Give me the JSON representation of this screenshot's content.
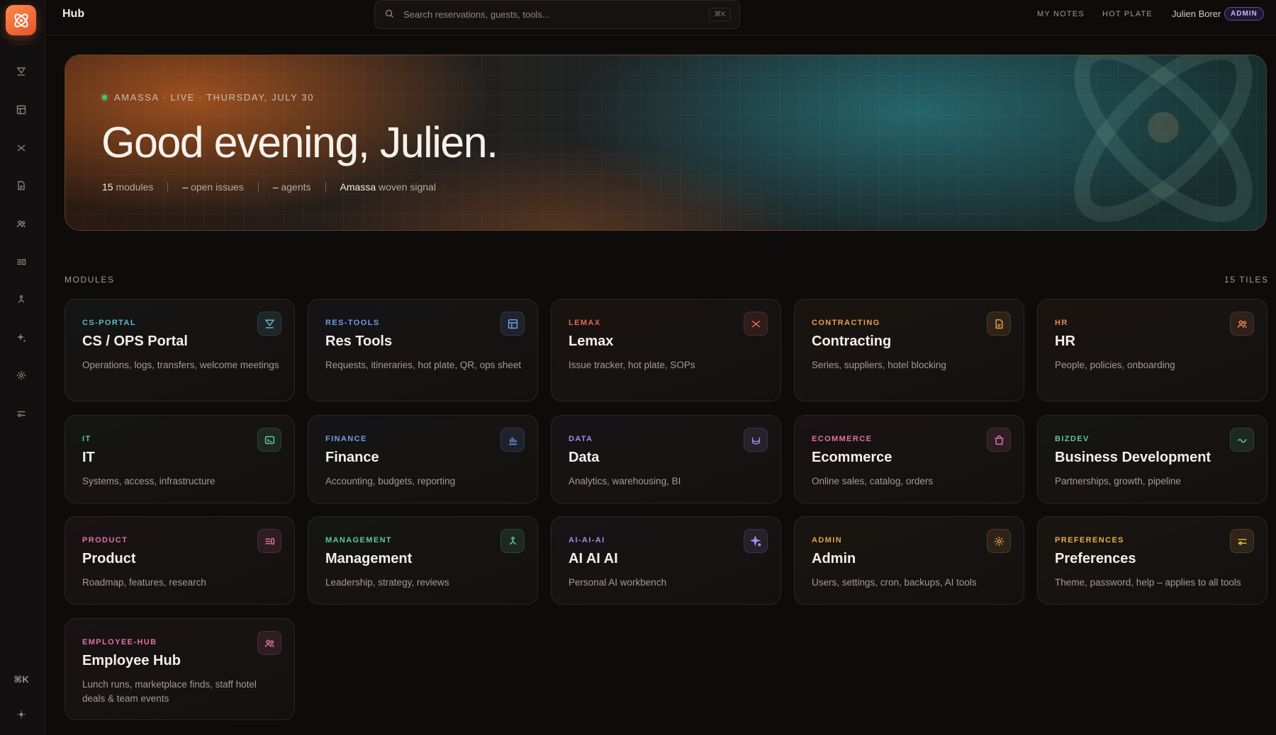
{
  "app": {
    "title": "Hub"
  },
  "search": {
    "placeholder": "Search reservations, guests, tools...",
    "shortcut": "⌘K"
  },
  "topbar": {
    "links": [
      "MY NOTES",
      "HOT PLATE"
    ],
    "user": {
      "name": "Julien Borer",
      "role": "ADMIN"
    }
  },
  "sidebar": {
    "icons": [
      "portal-icon",
      "table-icon",
      "lemax-icon",
      "document-icon",
      "people-icon",
      "product-icon",
      "management-icon",
      "sparkle-icon",
      "gear-icon",
      "sliders-icon"
    ],
    "shortcut": "⌘K",
    "theme_icon": "sun-icon"
  },
  "hero": {
    "eyebrow": "AMASSA · LIVE · THURSDAY, JULY 30",
    "greeting": "Good evening, Julien.",
    "stats": {
      "modules_count": "15",
      "modules_label": "modules",
      "issues_value": "–",
      "issues_label": "open issues",
      "agents_value": "–",
      "agents_label": "agents",
      "brand": "Amassa",
      "brand_suffix": "woven signal"
    }
  },
  "modules": {
    "label": "MODULES",
    "count_label": "15 TILES",
    "tiles": [
      {
        "tag": "CS-PORTAL",
        "name": "CS / OPS Portal",
        "desc": "Operations, logs, transfers, welcome meetings",
        "accent": "#5fb9c9",
        "icon": "portal-icon"
      },
      {
        "tag": "RES-TOOLS",
        "name": "Res Tools",
        "desc": "Requests, itineraries, hot plate, QR, ops sheet",
        "accent": "#6f9ee8",
        "icon": "table-icon"
      },
      {
        "tag": "LEMAX",
        "name": "Lemax",
        "desc": "Issue tracker, hot plate, SOPs",
        "accent": "#e06a5a",
        "icon": "lemax-icon"
      },
      {
        "tag": "CONTRACTING",
        "name": "Contracting",
        "desc": "Series, suppliers, hotel blocking",
        "accent": "#e6a04a",
        "icon": "document-icon"
      },
      {
        "tag": "HR",
        "name": "HR",
        "desc": "People, policies, onboarding",
        "accent": "#e08a5a",
        "icon": "people-icon"
      },
      {
        "tag": "IT",
        "name": "IT",
        "desc": "Systems, access, infrastructure",
        "accent": "#5fc79a",
        "icon": "terminal-icon"
      },
      {
        "tag": "FINANCE",
        "name": "Finance",
        "desc": "Accounting, budgets, reporting",
        "accent": "#6f9ee8",
        "icon": "bar-chart-icon"
      },
      {
        "tag": "DATA",
        "name": "Data",
        "desc": "Analytics, warehousing, BI",
        "accent": "#9a8ae8",
        "icon": "database-icon"
      },
      {
        "tag": "ECOMMERCE",
        "name": "Ecommerce",
        "desc": "Online sales, catalog, orders",
        "accent": "#e070a8",
        "icon": "bag-icon"
      },
      {
        "tag": "BIZDEV",
        "name": "Business Development",
        "desc": "Partnerships, growth, pipeline",
        "accent": "#5fc79a",
        "icon": "wave-icon"
      },
      {
        "tag": "PRODUCT",
        "name": "Product",
        "desc": "Roadmap, features, research",
        "accent": "#e070a8",
        "icon": "product-icon"
      },
      {
        "tag": "MANAGEMENT",
        "name": "Management",
        "desc": "Leadership, strategy, reviews",
        "accent": "#5fc7a8",
        "icon": "management-icon"
      },
      {
        "tag": "AI-AI-AI",
        "name": "AI AI AI",
        "desc": "Personal AI workbench",
        "accent": "#a68ae8",
        "icon": "sparkle-icon"
      },
      {
        "tag": "ADMIN",
        "name": "Admin",
        "desc": "Users, settings, cron, backups, AI tools",
        "accent": "#e6a04a",
        "icon": "gear-icon"
      },
      {
        "tag": "PREFERENCES",
        "name": "Preferences",
        "desc": "Theme, password, help – applies to all tools",
        "accent": "#e6b04a",
        "icon": "sliders-icon"
      },
      {
        "tag": "EMPLOYEE-HUB",
        "name": "Employee Hub",
        "desc": "Lunch runs, marketplace finds, staff hotel deals & team events",
        "accent": "#e070a8",
        "icon": "people-icon"
      }
    ]
  }
}
